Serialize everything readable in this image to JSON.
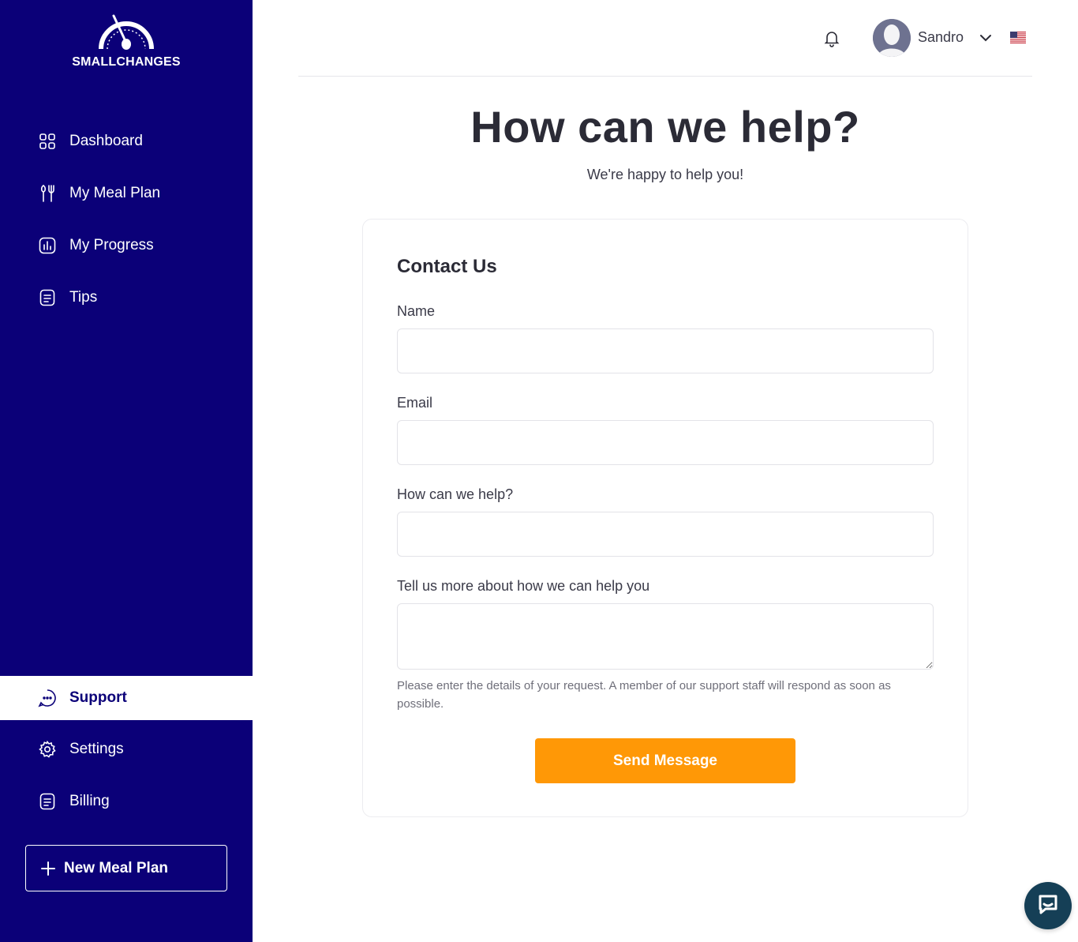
{
  "brand": {
    "name": "SMALLCHANGES"
  },
  "sidebar": {
    "items": [
      {
        "label": "Dashboard",
        "icon": "grid-icon"
      },
      {
        "label": "My Meal Plan",
        "icon": "fork-knife-icon"
      },
      {
        "label": "My Progress",
        "icon": "bar-chart-icon"
      },
      {
        "label": "Tips",
        "icon": "document-icon"
      }
    ],
    "active": {
      "label": "Support",
      "icon": "chat-icon"
    },
    "bottom_items": [
      {
        "label": "Settings",
        "icon": "gear-icon"
      },
      {
        "label": "Billing",
        "icon": "document-icon"
      }
    ],
    "new_plan_label": "New Meal Plan"
  },
  "header": {
    "user_name": "Sandro",
    "language_flag": "us-flag-icon"
  },
  "page": {
    "title": "How can we help?",
    "subtitle": "We're happy to help you!"
  },
  "form": {
    "title": "Contact Us",
    "name_label": "Name",
    "email_label": "Email",
    "topic_label": "How can we help?",
    "details_label": "Tell us more about how we can help you",
    "name_value": "",
    "email_value": "",
    "topic_value": "",
    "details_value": "",
    "helper_text": "Please enter the details of your request. A member of our support staff will respond as soon as possible.",
    "submit_label": "Send Message"
  },
  "colors": {
    "sidebar_bg": "#0b0078",
    "accent_button": "#ff9806",
    "chat_widget": "#153f56"
  }
}
